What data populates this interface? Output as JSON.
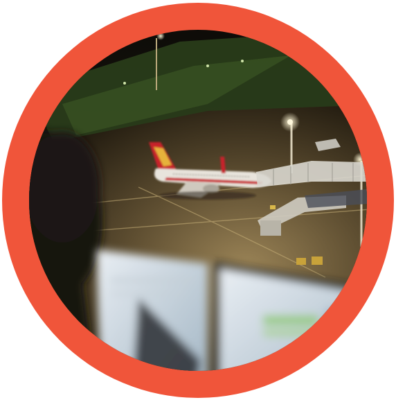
{
  "badge": {
    "ring_color": "#F0553A",
    "background": "#FFFFFF"
  },
  "scene": {
    "sky_color": "#0E0C08",
    "apron_color": "#6B5A3A",
    "grass_color": "#2E4A1E",
    "floodlight_color": "#FFF4C8",
    "aircraft_body_color": "#E8E4DC",
    "aircraft_tail_color": "#C8242A",
    "screen_glow_color": "#DDE6EE"
  }
}
